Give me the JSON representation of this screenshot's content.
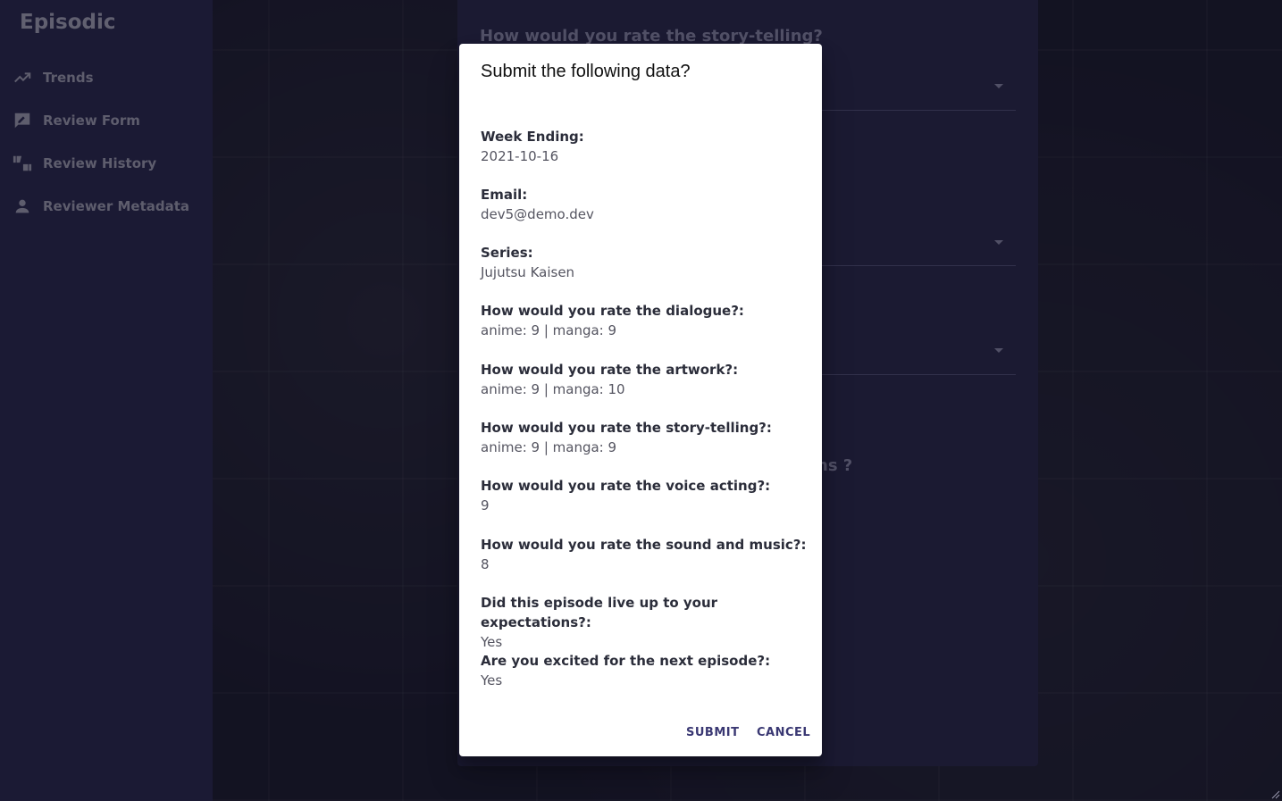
{
  "app": {
    "title": "Episodic"
  },
  "sidebar": {
    "items": [
      {
        "label": "Trends",
        "icon": "trending-up-icon"
      },
      {
        "label": "Review Form",
        "icon": "rate-review-icon"
      },
      {
        "label": "Review History",
        "icon": "thumbs-up-down-icon"
      },
      {
        "label": "Reviewer Metadata",
        "icon": "person-icon"
      }
    ]
  },
  "background_form": {
    "question_top": "How would you rate the story-telling?",
    "question_partial": "ns ?"
  },
  "dialog": {
    "title": "Submit the following data?",
    "fields": [
      {
        "label": "Week Ending:",
        "value": "2021-10-16"
      },
      {
        "label": "Email:",
        "value": "dev5@demo.dev"
      },
      {
        "label": "Series:",
        "value": "Jujutsu Kaisen"
      },
      {
        "label": "How would you rate the dialogue?:",
        "value": "anime: 9 | manga: 9"
      },
      {
        "label": "How would you rate the artwork?:",
        "value": "anime: 9 | manga: 10"
      },
      {
        "label": "How would you rate the story-telling?:",
        "value": "anime: 9 | manga: 9"
      },
      {
        "label": "How would you rate the voice acting?:",
        "value": "9"
      },
      {
        "label": "How would you rate the sound and music?:",
        "value": "8"
      },
      {
        "label": "Did this episode live up to your expectations?:",
        "value": "Yes"
      },
      {
        "label": "Are you excited for the next episode?:",
        "value": "Yes"
      }
    ],
    "submit_label": "SUBMIT",
    "cancel_label": "CANCEL"
  },
  "colors": {
    "sidebar": "#2b2950",
    "panel": "#2a284d",
    "accent": "#3a3873"
  }
}
